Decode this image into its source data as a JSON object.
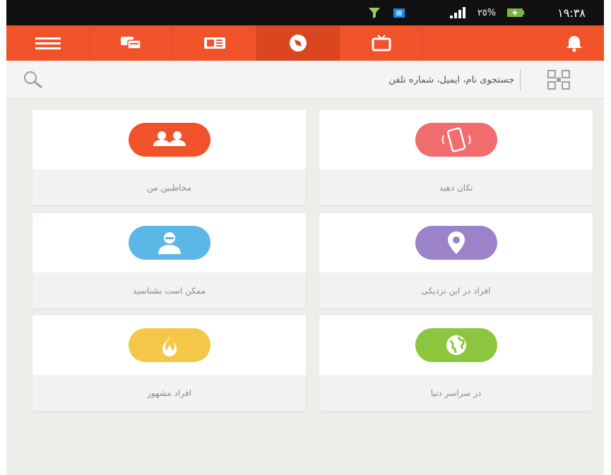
{
  "status_bar": {
    "time": "١٩:٣٨",
    "battery_percent": "٢٥%",
    "icons": [
      "notification-app-icon",
      "wifi-icon",
      "signal-icon",
      "battery-charging-icon"
    ]
  },
  "toolbar": {
    "tabs": [
      {
        "name": "menu",
        "icon": "hamburger-menu-icon"
      },
      {
        "name": "chats",
        "icon": "chat-bubbles-icon"
      },
      {
        "name": "news",
        "icon": "newspaper-icon"
      },
      {
        "name": "discover",
        "icon": "compass-icon",
        "active": true
      },
      {
        "name": "tv",
        "icon": "tv-icon"
      },
      {
        "name": "notifications",
        "icon": "bell-icon"
      }
    ]
  },
  "search": {
    "placeholder": "جستجوی نام، ایمیل، شماره تلفن",
    "icon": "search-icon",
    "qr_icon": "qr-code-icon"
  },
  "cards": [
    {
      "label": "تکان دهید",
      "icon": "shake-phone-icon",
      "color": "#f26d6d"
    },
    {
      "label": "مخاطبین من",
      "icon": "contacts-icon",
      "color": "#f0532a"
    },
    {
      "label": "افراد در این نزدیکی",
      "icon": "location-pin-icon",
      "color": "#9b82c9"
    },
    {
      "label": "ممکن است بشناسید",
      "icon": "person-icon",
      "color": "#5bb7e6"
    },
    {
      "label": "در سراسر دنیا",
      "icon": "globe-icon",
      "color": "#8cc63e"
    },
    {
      "label": "افراد مشهور",
      "icon": "flame-icon",
      "color": "#f5c748"
    }
  ],
  "colors": {
    "accent": "#f0532a",
    "accent_dark": "#d9461f",
    "background": "#efedea",
    "status_bar": "#111111"
  }
}
